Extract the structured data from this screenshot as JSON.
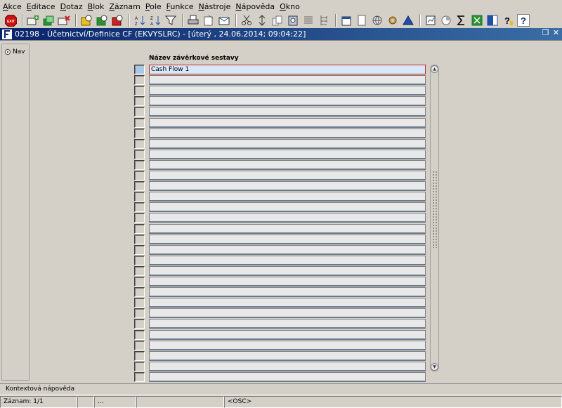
{
  "menu": [
    {
      "id": "akce",
      "first": "A",
      "rest": "kce"
    },
    {
      "id": "editace",
      "first": "E",
      "rest": "ditace"
    },
    {
      "id": "dotaz",
      "first": "D",
      "rest": "otaz"
    },
    {
      "id": "blok",
      "first": "B",
      "rest": "lok"
    },
    {
      "id": "zaznam",
      "first": "Z",
      "rest": "áznam"
    },
    {
      "id": "pole",
      "first": "P",
      "rest": "ole"
    },
    {
      "id": "funkce",
      "first": "F",
      "rest": "unkce"
    },
    {
      "id": "nastroje",
      "first": "N",
      "rest": "ástroje"
    },
    {
      "id": "napoveda",
      "first": "N",
      "rest": "ápověda"
    },
    {
      "id": "okno",
      "first": "O",
      "rest": "kno"
    }
  ],
  "toolbar": {
    "exit_label": "EXIT",
    "colors": {
      "exit": "#cc1111",
      "green": "#2f8f2f",
      "red": "#cc2222",
      "blue": "#1f4fa8",
      "yellow": "#e8c020"
    }
  },
  "window": {
    "title": "02198 - Účetnictví/Definice CF (EKVYSLRC) - [úterý , 24.06.2014; 09:04:22]",
    "app_icon": "f-icon",
    "restore_glyph": "❐",
    "close_glyph": "✕"
  },
  "nav": {
    "label": "Nav",
    "selected": true
  },
  "grid": {
    "column_header": "Název závěrkové sestavy",
    "rows": [
      "Cash Flow 1",
      "",
      "",
      "",
      "",
      "",
      "",
      "",
      "",
      "",
      "",
      "",
      "",
      "",
      "",
      "",
      "",
      "",
      "",
      "",
      "",
      "",
      "",
      "",
      "",
      "",
      "",
      "",
      "",
      ""
    ],
    "current_row": 0
  },
  "scroll": {
    "up_glyph": "▲",
    "down_glyph": "▼"
  },
  "status": {
    "hint": "Kontextová nápověda",
    "record": "Záznam: 1/1",
    "pane2": "",
    "pane3": "...",
    "pane4": "",
    "osc": "<OSC>"
  }
}
